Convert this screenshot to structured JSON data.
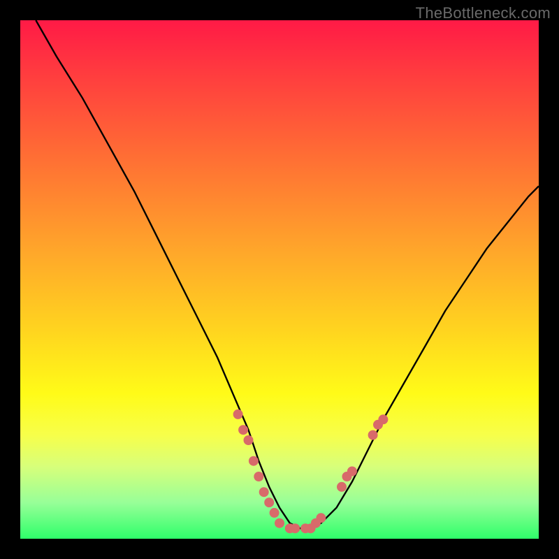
{
  "watermark": "TheBottleneck.com",
  "colors": {
    "frame_bg_top": "#ff1a46",
    "frame_bg_bottom": "#2fff6a",
    "curve_stroke": "#000000",
    "marker_fill": "#d86a6a",
    "page_bg": "#000000",
    "watermark_text": "#6a6a6a"
  },
  "chart_data": {
    "type": "line",
    "title": "",
    "xlabel": "",
    "ylabel": "",
    "xlim": [
      0,
      100
    ],
    "ylim": [
      0,
      100
    ],
    "grid": false,
    "legend": false,
    "series": [
      {
        "name": "bottleneck-curve",
        "x": [
          3,
          7,
          12,
          17,
          22,
          26,
          30,
          34,
          38,
          41,
          44,
          46,
          48,
          50,
          52,
          54,
          56,
          58,
          61,
          64,
          67,
          70,
          74,
          78,
          82,
          86,
          90,
          94,
          98,
          100
        ],
        "y": [
          100,
          93,
          85,
          76,
          67,
          59,
          51,
          43,
          35,
          28,
          21,
          15,
          10,
          6,
          3,
          2,
          2,
          3,
          6,
          11,
          17,
          23,
          30,
          37,
          44,
          50,
          56,
          61,
          66,
          68
        ]
      }
    ],
    "markers": [
      {
        "x": 42,
        "y": 24
      },
      {
        "x": 43,
        "y": 21
      },
      {
        "x": 44,
        "y": 19
      },
      {
        "x": 45,
        "y": 15
      },
      {
        "x": 46,
        "y": 12
      },
      {
        "x": 47,
        "y": 9
      },
      {
        "x": 48,
        "y": 7
      },
      {
        "x": 49,
        "y": 5
      },
      {
        "x": 50,
        "y": 3
      },
      {
        "x": 52,
        "y": 2
      },
      {
        "x": 53,
        "y": 2
      },
      {
        "x": 55,
        "y": 2
      },
      {
        "x": 56,
        "y": 2
      },
      {
        "x": 57,
        "y": 3
      },
      {
        "x": 58,
        "y": 4
      },
      {
        "x": 62,
        "y": 10
      },
      {
        "x": 63,
        "y": 12
      },
      {
        "x": 64,
        "y": 13
      },
      {
        "x": 68,
        "y": 20
      },
      {
        "x": 69,
        "y": 22
      },
      {
        "x": 70,
        "y": 23
      }
    ]
  }
}
